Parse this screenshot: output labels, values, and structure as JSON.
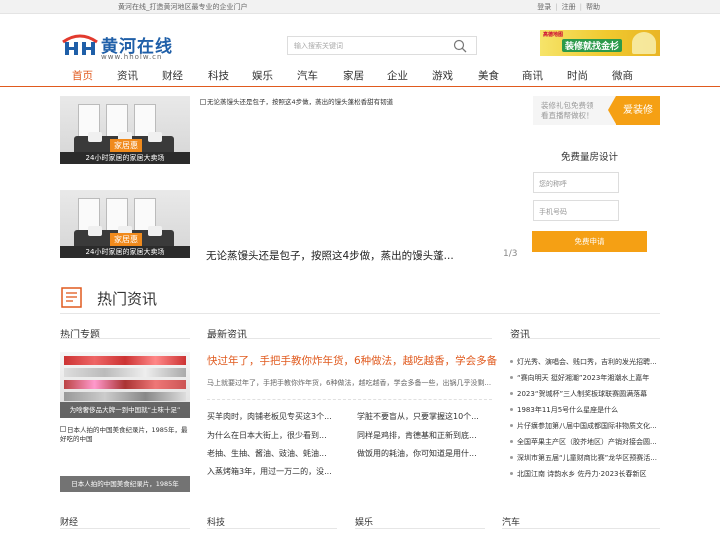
{
  "topbar": {
    "welcome": "黄河在线_打造黄河地区最专业的企业门户",
    "links": [
      "登录",
      "注册",
      "帮助"
    ]
  },
  "logo": {
    "name": "黄河在线",
    "url": "www.hholw.cn"
  },
  "search": {
    "placeholder": "输入搜索关键词"
  },
  "banner_ad": {
    "brand": "高德地图",
    "slogan": "装修就找金杉"
  },
  "nav": {
    "items": [
      "首页",
      "资讯",
      "财经",
      "科技",
      "娱乐",
      "汽车",
      "家居",
      "企业",
      "游戏",
      "美食",
      "商讯",
      "时尚",
      "微商"
    ],
    "active_index": 0
  },
  "slider": {
    "thumbs": [
      {
        "badge": "家居惠",
        "caption": "24小时家居的家居大卖场"
      },
      {
        "badge": "家居惠",
        "caption": "24小时家居的家居大卖场"
      }
    ],
    "main_image_alt": "无论蒸馒头还是包子，按照这4步做，蒸出的馒头蓬松香甜有韧道",
    "title": "无论蒸馒头还是包子，按照这4步做，蒸出的馒头蓬...",
    "counter": "1/3"
  },
  "promo": {
    "head_text_1": "装修礼包免费领",
    "head_text_2": "看直播帮做权！",
    "tag": "爱装修",
    "title": "免费量房设计",
    "name_placeholder": "您的称呼",
    "phone_placeholder": "手机号码",
    "button": "免费申请"
  },
  "hot": {
    "title": "热门资讯",
    "col_topics": "热门专题",
    "col_latest": "最新资讯",
    "col_news": "资讯"
  },
  "topics": [
    {
      "caption": "为啥奢侈品大牌一到中国就“土味十足”"
    },
    {
      "alt": "日本人拍的中国美食纪录片，1985年，最好吃的中国",
      "caption": "日本人拍的中国美食纪录片，1985年"
    }
  ],
  "latest": {
    "lead_title": "快过年了，手把手教你炸年货，6种做法，越吃越香，学会多备",
    "lead_desc": "马上就要过年了，手把手教你炸年货，6种做法，越吃越香，学会多备一些，出锅几乎没剩...",
    "left": [
      "买羊肉时，肉铺老板见专买这3个...",
      "为什么在日本大街上，很少看到...",
      "老抽、生抽、酱油、豉油、蚝油...",
      "入蒸烤箱3年，用过一万二的，没..."
    ],
    "right": [
      "学脏不要盲从，只要掌握这10个...",
      "同样是鸡排，肯德基和正新到底...",
      "做饭用的耗油，你可知道是用什...",
      ""
    ]
  },
  "news_list": [
    "灯光秀、演唱会、贱口秀，吉利的发光招聘...",
    "“赛向明天 挺好湘潮”2023年湘潮水上嘉年",
    "2023“贺城杯”三人制奖板球联赛圆满落幕",
    "1983年11月5号什么星座是什么",
    "片仔癀参加第八届中国成都国际非物质文化...",
    "全国苹果主产区（胶芥地区）产销对接会圆...",
    "深圳市第五届“儿童财商比赛”龙华区预赛活...",
    "北国江南 诗韵水乡 佐丹力·2023长春新区"
  ],
  "bottom_sections": [
    "财经",
    "科技",
    "娱乐",
    "汽车"
  ],
  "colors": {
    "accent": "#e05a1e",
    "promo": "#f5a014",
    "logo_blue": "#1f5fa8"
  }
}
